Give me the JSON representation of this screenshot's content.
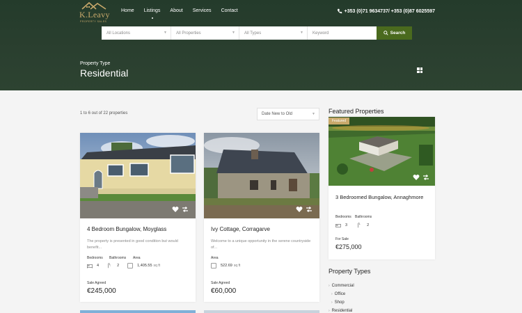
{
  "brand": {
    "name": "K.Leavy",
    "tagline": "PROPERTY SALES",
    "accent": "#c9a96b"
  },
  "nav": {
    "items": [
      {
        "label": "Home"
      },
      {
        "label": "Listings",
        "active": true
      },
      {
        "label": "About"
      },
      {
        "label": "Services"
      },
      {
        "label": "Contact"
      }
    ],
    "phone": "+353 (0)71 9634737/ +353 (0)87 6025597"
  },
  "search": {
    "location": "All Locations",
    "properties": "All Properties",
    "types": "All Types",
    "keyword_placeholder": "Keyword",
    "button_label": "Search",
    "button_color": "#4a6a1e"
  },
  "hero": {
    "label": "Property Type",
    "title": "Residential"
  },
  "toolbar": {
    "count": "1 to 6 out of 22 properties",
    "sort": "Date New to Old"
  },
  "listings": [
    {
      "title": "4 Bedroom Bungalow, Moyglass",
      "desc": "The property is presented in good condition but would benefit...",
      "labels": [
        "Bedrooms",
        "Bathrooms",
        "Area"
      ],
      "bedrooms": "4",
      "bathrooms": "2",
      "area": "1,405.55",
      "area_unit": "sq ft",
      "status": "Sale Agreed",
      "price": "€245,000"
    },
    {
      "title": "Ivy Cottage, Corragarve",
      "desc": "Welcome to a unique opportunity in the serene countryside of...",
      "labels": [
        "Area"
      ],
      "area": "522.69",
      "area_unit": "sq ft",
      "status": "Sale Agreed",
      "price": "€60,000"
    }
  ],
  "sidebar": {
    "featured_title": "Featured Properties",
    "featured": {
      "badge": "Featured",
      "title": "3 Bedroomed Bungalow, Annaghmore",
      "labels": [
        "Bedrooms",
        "Bathrooms"
      ],
      "bedrooms": "3",
      "bathrooms": "2",
      "status": "For Sale",
      "price": "€275,000"
    },
    "types_title": "Property Types",
    "types": [
      {
        "label": "Commercial",
        "sub": false
      },
      {
        "label": "Office",
        "sub": true
      },
      {
        "label": "Shop",
        "sub": true
      },
      {
        "label": "Residential",
        "sub": false
      }
    ]
  }
}
